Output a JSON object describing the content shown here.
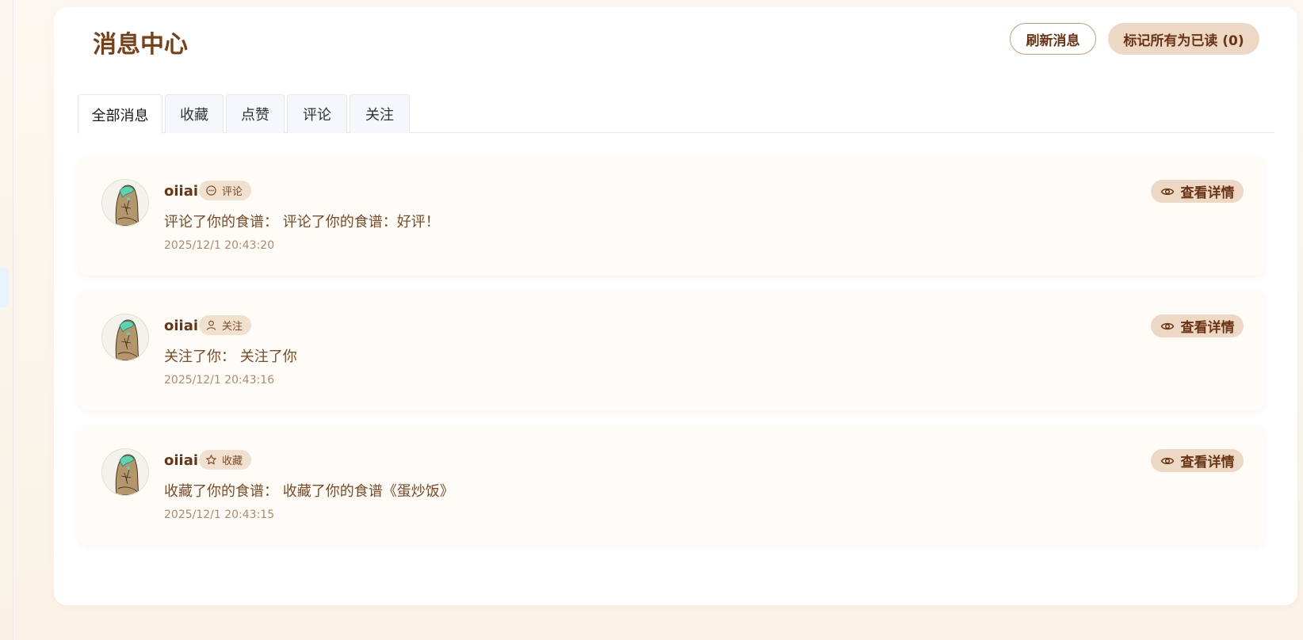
{
  "header": {
    "title": "消息中心",
    "refresh_label": "刷新消息",
    "mark_all_label": "标记所有为已读 (0)"
  },
  "tabs": [
    {
      "label": "全部消息",
      "active": true
    },
    {
      "label": "收藏",
      "active": false
    },
    {
      "label": "点赞",
      "active": false
    },
    {
      "label": "评论",
      "active": false
    },
    {
      "label": "关注",
      "active": false
    }
  ],
  "messages": [
    {
      "user": "oiiai",
      "type_label": "评论",
      "icon": "comment-icon",
      "text": "评论了你的食谱：  评论了你的食谱：好评！",
      "time": "2025/12/1 20:43:20",
      "action": "查看详情"
    },
    {
      "user": "oiiai",
      "type_label": "关注",
      "icon": "user-icon",
      "text": "关注了你：  关注了你",
      "time": "2025/12/1 20:43:16",
      "action": "查看详情"
    },
    {
      "user": "oiiai",
      "type_label": "收藏",
      "icon": "star-icon",
      "text": "收藏了你的食谱：  收藏了你的食谱《蛋炒饭》",
      "time": "2025/12/1 20:43:15",
      "action": "查看详情"
    }
  ],
  "colors": {
    "brand": "#7a3f14",
    "tag_bg": "#f2e0cf",
    "button_bg": "#ecd8c5",
    "card_bg": "#fffcf8"
  }
}
